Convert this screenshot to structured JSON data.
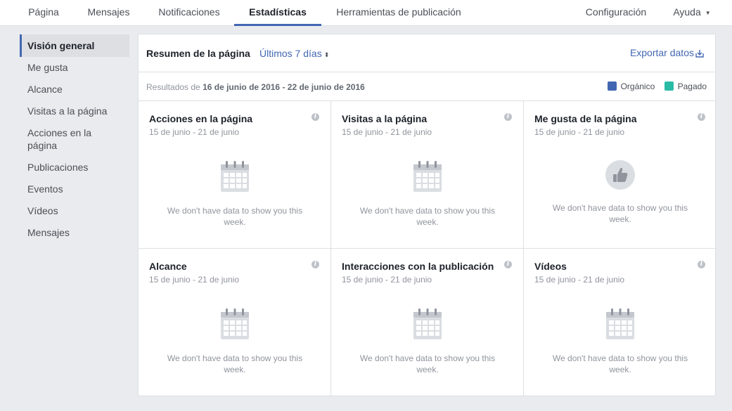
{
  "topnav": {
    "tabs": [
      {
        "label": "Página",
        "active": false
      },
      {
        "label": "Mensajes",
        "active": false
      },
      {
        "label": "Notificaciones",
        "active": false
      },
      {
        "label": "Estadísticas",
        "active": true
      },
      {
        "label": "Herramientas de publicación",
        "active": false
      }
    ],
    "settings": "Configuración",
    "help": "Ayuda"
  },
  "sidebar": {
    "items": [
      {
        "label": "Visión general",
        "active": true
      },
      {
        "label": "Me gusta",
        "active": false
      },
      {
        "label": "Alcance",
        "active": false
      },
      {
        "label": "Visitas a la página",
        "active": false
      },
      {
        "label": "Acciones en la página",
        "active": false
      },
      {
        "label": "Publicaciones",
        "active": false
      },
      {
        "label": "Eventos",
        "active": false
      },
      {
        "label": "Vídeos",
        "active": false
      },
      {
        "label": "Mensajes",
        "active": false
      }
    ]
  },
  "main": {
    "title": "Resumen de la página",
    "period": "Últimos 7 días",
    "export": "Exportar datos",
    "results_prefix": "Resultados de",
    "results_range": "16 de junio de 2016 - 22 de junio de 2016",
    "legend": [
      {
        "label": "Orgánico",
        "color": "#4267b2"
      },
      {
        "label": "Pagado",
        "color": "#2abba7"
      }
    ],
    "cards": [
      {
        "title": "Acciones en la página",
        "date": "15 de junio - 21 de junio",
        "icon": "calendar-icon",
        "message": "We don't have data to show you this week."
      },
      {
        "title": "Visitas a la página",
        "date": "15 de junio - 21 de junio",
        "icon": "calendar-icon",
        "message": "We don't have data to show you this week."
      },
      {
        "title": "Me gusta de la página",
        "date": "15 de junio - 21 de junio",
        "icon": "thumbs-up-icon",
        "message": "We don't have data to show you this week."
      },
      {
        "title": "Alcance",
        "date": "15 de junio - 21 de junio",
        "icon": "calendar-icon",
        "message": "We don't have data to show you this week."
      },
      {
        "title": "Interacciones con la publicación",
        "date": "15 de junio - 21 de junio",
        "icon": "calendar-icon",
        "message": "We don't have data to show you this week."
      },
      {
        "title": "Vídeos",
        "date": "15 de junio - 21 de junio",
        "icon": "calendar-icon",
        "message": "We don't have data to show you this week."
      }
    ]
  }
}
